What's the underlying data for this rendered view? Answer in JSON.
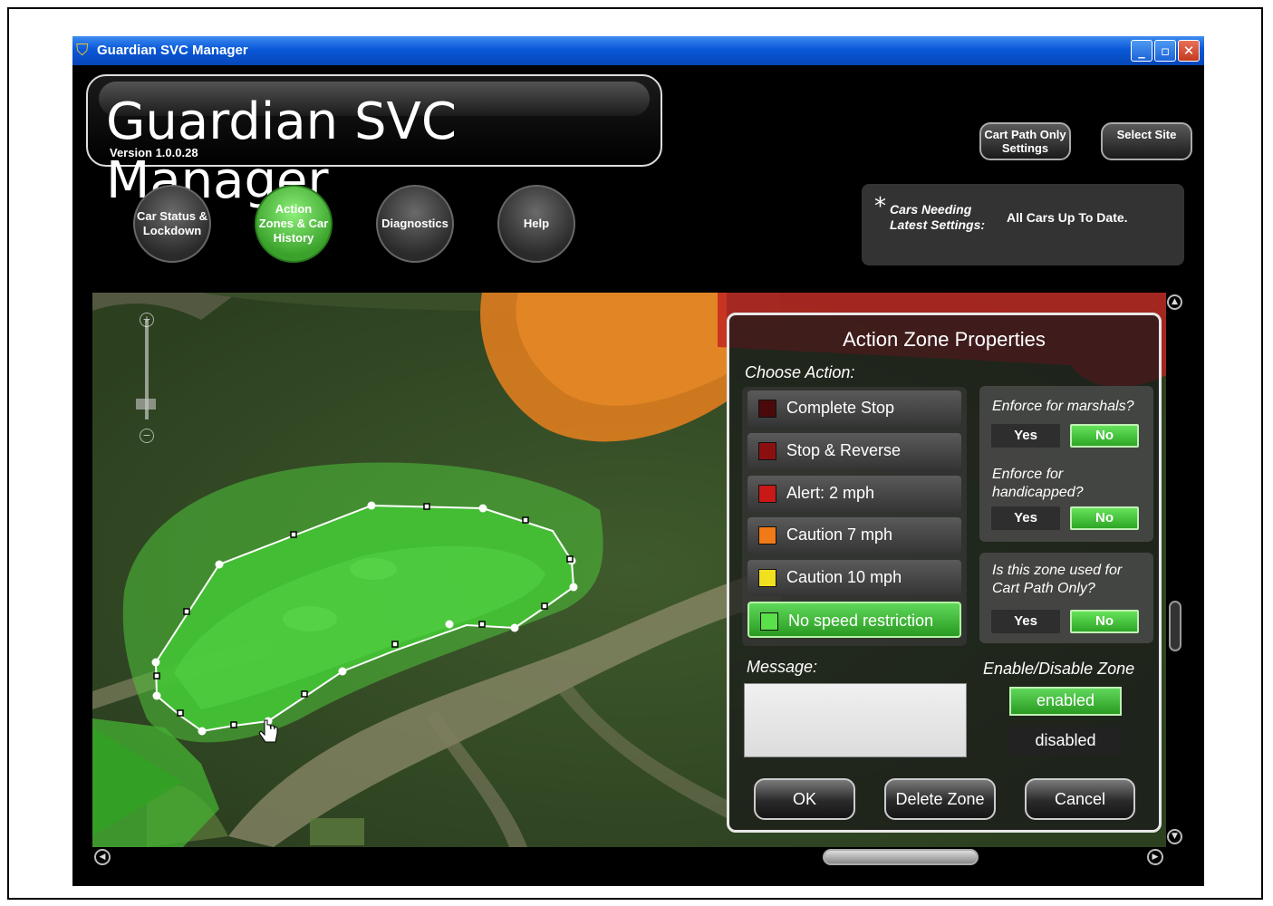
{
  "window": {
    "title": "Guardian SVC Manager",
    "controls": [
      "minimize",
      "maximize",
      "close"
    ]
  },
  "header": {
    "app_title": "Guardian SVC Manager",
    "version": "Version 1.0.0.28",
    "cart_path_button": "Cart Path Only Settings",
    "select_site_button": "Select Site"
  },
  "nav": {
    "items": [
      {
        "label": "Car Status & Lockdown",
        "active": false
      },
      {
        "label": "Action Zones & Car History",
        "active": true
      },
      {
        "label": "Diagnostics",
        "active": false
      },
      {
        "label": "Help",
        "active": false
      }
    ]
  },
  "status": {
    "star": "*",
    "label": "Cars Needing\nLatest Settings:",
    "value": "All Cars Up To Date."
  },
  "zone_properties": {
    "title": "Action Zone Properties",
    "choose_action_label": "Choose Action:",
    "actions": [
      {
        "label": "Complete Stop",
        "color": "#4a0a0a",
        "selected": false
      },
      {
        "label": "Stop & Reverse",
        "color": "#8a1010",
        "selected": false
      },
      {
        "label": "Alert: 2 mph",
        "color": "#c81818",
        "selected": false
      },
      {
        "label": "Caution 7 mph",
        "color": "#f07a18",
        "selected": false
      },
      {
        "label": "Caution 10 mph",
        "color": "#f0e020",
        "selected": false
      },
      {
        "label": "No speed restriction",
        "color": "#5ae048",
        "selected": true
      }
    ],
    "marshals": {
      "question": "Enforce for marshals?",
      "yes": "Yes",
      "no": "No",
      "value": "No"
    },
    "handicapped": {
      "question": "Enforce for\nhandicapped?",
      "yes": "Yes",
      "no": "No",
      "value": "No"
    },
    "cart_path": {
      "question": "Is this zone used for\nCart Path Only?",
      "yes": "Yes",
      "no": "No",
      "value": "No"
    },
    "message_label": "Message:",
    "message_value": "",
    "enable_label": "Enable/Disable Zone",
    "enabled_label": "enabled",
    "disabled_label": "disabled",
    "zone_state": "enabled",
    "ok": "OK",
    "delete": "Delete Zone",
    "cancel": "Cancel"
  },
  "map": {
    "zoom_in": "+",
    "zoom_out": "−"
  },
  "colors": {
    "accent_green": "#4cc23e",
    "titlebar_blue": "#0a58d8",
    "zone_fill": "#39c82e"
  }
}
